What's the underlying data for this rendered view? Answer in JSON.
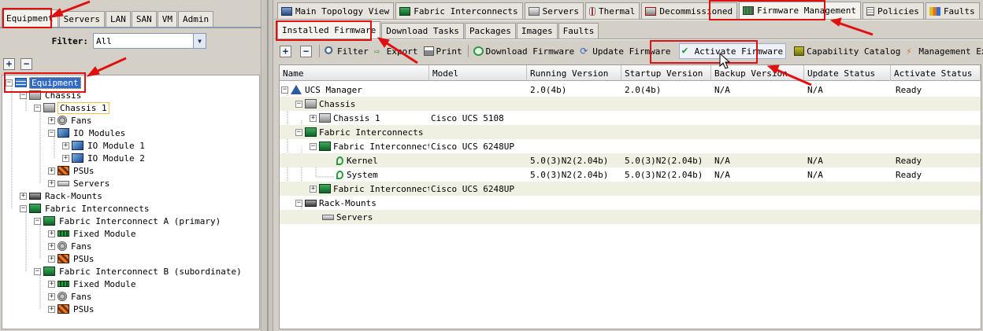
{
  "left": {
    "nav_tabs": [
      "Equipment",
      "Servers",
      "LAN",
      "SAN",
      "VM",
      "Admin"
    ],
    "filter": {
      "label": "Filter:",
      "value": "All"
    },
    "tree": [
      {
        "label": "Equipment",
        "icon": "equipment-icon",
        "selected": true
      },
      {
        "label": "Chassis",
        "icon": "chassis-icon"
      },
      {
        "label": "Chassis 1",
        "icon": "chassis-icon",
        "highlighted": true
      },
      {
        "label": "Fans",
        "icon": "fan-icon"
      },
      {
        "label": "IO Modules",
        "icon": "io-module-icon"
      },
      {
        "label": "IO Module 1",
        "icon": "io-module-icon"
      },
      {
        "label": "IO Module 2",
        "icon": "io-module-icon"
      },
      {
        "label": "PSUs",
        "icon": "psu-icon"
      },
      {
        "label": "Servers",
        "icon": "server-icon"
      },
      {
        "label": "Rack-Mounts",
        "icon": "rack-mount-icon"
      },
      {
        "label": "Fabric Interconnects",
        "icon": "fabric-interconnect-icon"
      },
      {
        "label": "Fabric Interconnect A (primary)",
        "icon": "fabric-interconnect-icon"
      },
      {
        "label": "Fixed Module",
        "icon": "fixed-module-icon"
      },
      {
        "label": "Fans",
        "icon": "fan-icon"
      },
      {
        "label": "PSUs",
        "icon": "psu-icon"
      },
      {
        "label": "Fabric Interconnect B (subordinate)",
        "icon": "fabric-interconnect-icon"
      },
      {
        "label": "Fixed Module",
        "icon": "fixed-module-icon"
      },
      {
        "label": "Fans",
        "icon": "fan-icon"
      },
      {
        "label": "PSUs",
        "icon": "psu-icon"
      }
    ]
  },
  "right": {
    "top_tabs": [
      "Main Topology View",
      "Fabric Interconnects",
      "Servers",
      "Thermal",
      "Decommissioned",
      "Firmware Management",
      "Policies",
      "Faults"
    ],
    "sub_tabs": [
      "Installed Firmware",
      "Download Tasks",
      "Packages",
      "Images",
      "Faults"
    ],
    "toolbar": [
      "Filter",
      "Export",
      "Print",
      "Download Firmware",
      "Update Firmware",
      "Activate Firmware",
      "Capability Catalog",
      "Management Extension"
    ],
    "columns": [
      "Name",
      "Model",
      "Running Version",
      "Startup Version",
      "Backup Version",
      "Update Status",
      "Activate Status"
    ],
    "rows": [
      {
        "name": "UCS Manager",
        "icon": "ucs-manager-icon",
        "model": "",
        "running": "2.0(4b)",
        "startup": "2.0(4b)",
        "backup": "N/A",
        "update": "N/A",
        "activate": "Ready"
      },
      {
        "name": "Chassis",
        "icon": "chassis-icon",
        "model": "",
        "running": "",
        "startup": "",
        "backup": "",
        "update": "",
        "activate": ""
      },
      {
        "name": "Chassis 1",
        "icon": "chassis-icon",
        "model": "Cisco UCS 5108",
        "running": "",
        "startup": "",
        "backup": "",
        "update": "",
        "activate": ""
      },
      {
        "name": "Fabric Interconnects",
        "icon": "fabric-interconnect-icon",
        "model": "",
        "running": "",
        "startup": "",
        "backup": "",
        "update": "",
        "activate": ""
      },
      {
        "name": "Fabric Interconnect",
        "icon": "fabric-interconnect-icon",
        "model": "Cisco UCS 6248UP",
        "running": "",
        "startup": "",
        "backup": "",
        "update": "",
        "activate": ""
      },
      {
        "name": "Kernel",
        "icon": "firmware-icon",
        "model": "",
        "running": "5.0(3)N2(2.04b)",
        "startup": "5.0(3)N2(2.04b)",
        "backup": "N/A",
        "update": "N/A",
        "activate": "Ready"
      },
      {
        "name": "System",
        "icon": "firmware-icon",
        "model": "",
        "running": "5.0(3)N2(2.04b)",
        "startup": "5.0(3)N2(2.04b)",
        "backup": "N/A",
        "update": "N/A",
        "activate": "Ready"
      },
      {
        "name": "Fabric Interconnect",
        "icon": "fabric-interconnect-icon",
        "model": "Cisco UCS 6248UP",
        "running": "",
        "startup": "",
        "backup": "",
        "update": "",
        "activate": ""
      },
      {
        "name": "Rack-Mounts",
        "icon": "rack-mount-icon",
        "model": "",
        "running": "",
        "startup": "",
        "backup": "",
        "update": "",
        "activate": ""
      },
      {
        "name": "Servers",
        "icon": "server-icon",
        "model": "",
        "running": "",
        "startup": "",
        "backup": "",
        "update": "",
        "activate": ""
      }
    ]
  },
  "colors": {
    "selection": "#3169c6",
    "annotation": "#e01010",
    "row_alt": "#f0f0e2"
  }
}
